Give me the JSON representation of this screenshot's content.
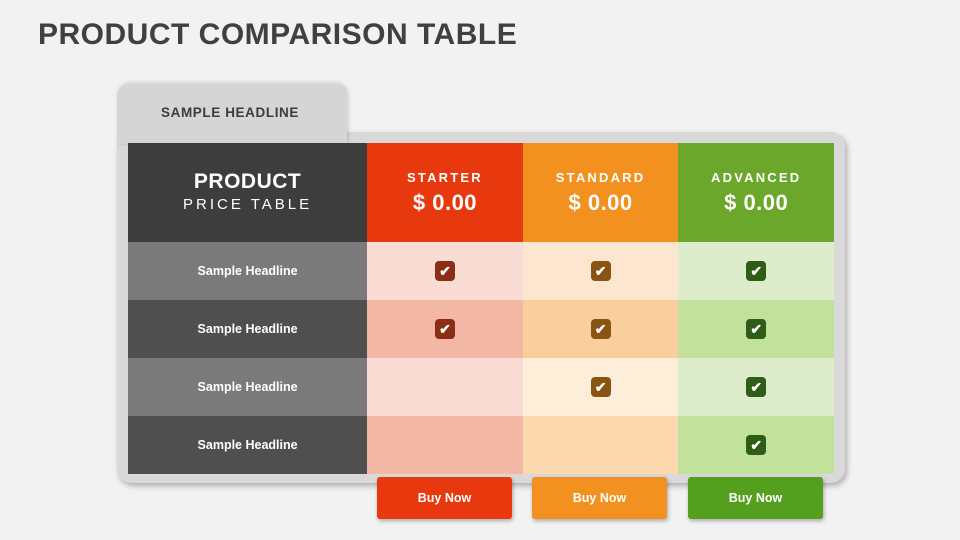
{
  "page": {
    "title": "PRODUCT COMPARISON TABLE",
    "tab_headline": "SAMPLE HEADLINE"
  },
  "table": {
    "header": {
      "product_line1": "PRODUCT",
      "product_line2": "PRICE TABLE",
      "plans": [
        {
          "name": "STARTER",
          "price": "$ 0.00",
          "color": "#e8380d"
        },
        {
          "name": "STANDARD",
          "price": "$ 0.00",
          "color": "#f29120"
        },
        {
          "name": "ADVANCED",
          "price": "$ 0.00",
          "color": "#6aa72a"
        }
      ]
    },
    "rows": [
      {
        "label": "Sample Headline",
        "label_bg": "#7a7a7a",
        "cells": [
          {
            "bg": "#f9dcd4",
            "check": true,
            "check_color": "red"
          },
          {
            "bg": "#fde6cf",
            "check": true,
            "check_color": "orange"
          },
          {
            "bg": "#ddeccb",
            "check": true,
            "check_color": "green"
          }
        ]
      },
      {
        "label": "Sample Headline",
        "label_bg": "#4f4f4f",
        "cells": [
          {
            "bg": "#f3b7a6",
            "check": true,
            "check_color": "red"
          },
          {
            "bg": "#f9cf9e",
            "check": true,
            "check_color": "orange"
          },
          {
            "bg": "#c2e19b",
            "check": true,
            "check_color": "green"
          }
        ]
      },
      {
        "label": "Sample Headline",
        "label_bg": "#7a7a7a",
        "cells": [
          {
            "bg": "#f9dcd4",
            "check": false,
            "check_color": "none"
          },
          {
            "bg": "#fdeeda",
            "check": true,
            "check_color": "orange"
          },
          {
            "bg": "#ddeccb",
            "check": true,
            "check_color": "green"
          }
        ]
      },
      {
        "label": "Sample Headline",
        "label_bg": "#4f4f4f",
        "cells": [
          {
            "bg": "#f3b7a6",
            "check": false,
            "check_color": "none"
          },
          {
            "bg": "#fbd8ad",
            "check": false,
            "check_color": "none"
          },
          {
            "bg": "#c2e19b",
            "check": true,
            "check_color": "green"
          }
        ]
      }
    ]
  },
  "buttons": [
    {
      "label": "Buy Now",
      "id": "buy-starter",
      "color": "#e8380d"
    },
    {
      "label": "Buy Now",
      "id": "buy-standard",
      "color": "#f29120"
    },
    {
      "label": "Buy Now",
      "id": "buy-advanced",
      "color": "#54a01e"
    }
  ],
  "icons": {
    "check_glyph": "✔"
  }
}
